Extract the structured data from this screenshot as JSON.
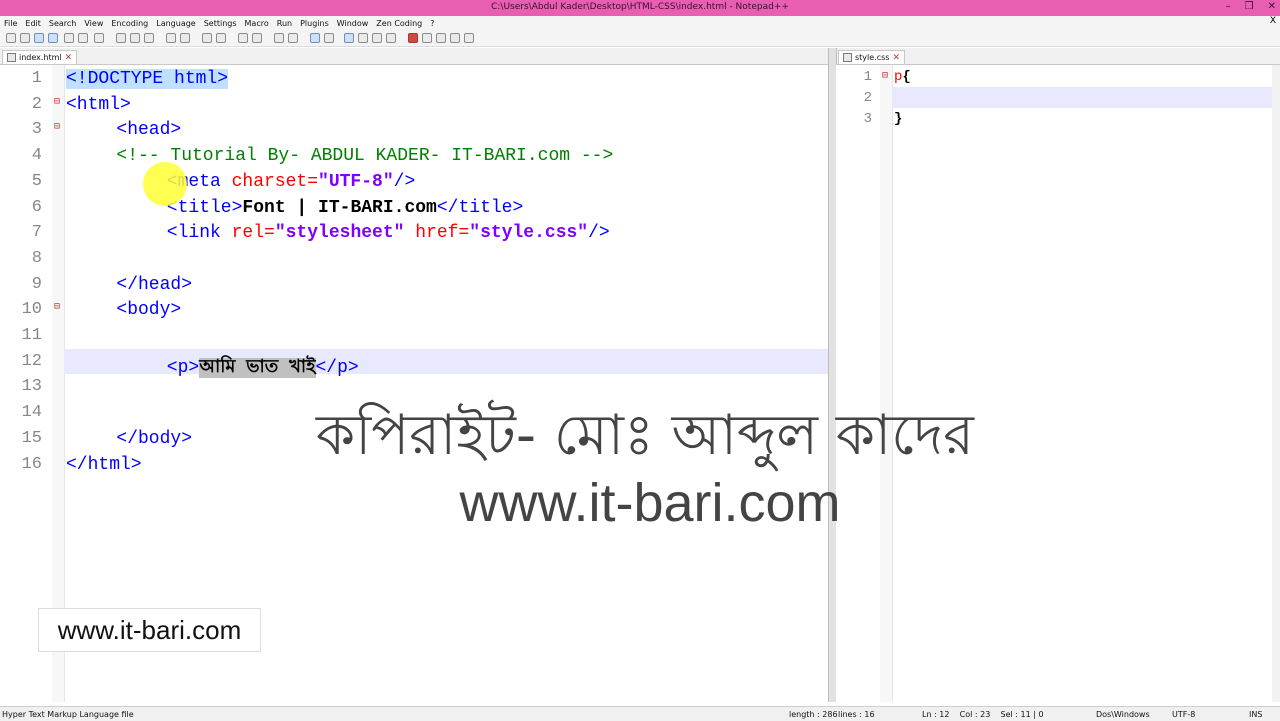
{
  "window": {
    "title": "C:\\Users\\Abdul Kader\\Desktop\\HTML-CSS\\index.html - Notepad++",
    "controls": [
      "–",
      "❒",
      "✕"
    ]
  },
  "menu": [
    "File",
    "Edit",
    "Search",
    "View",
    "Encoding",
    "Language",
    "Settings",
    "Macro",
    "Run",
    "Plugins",
    "Window",
    "Zen Coding",
    "?"
  ],
  "menu_close": "X",
  "colors": {
    "titlebar": "#e85fb1",
    "tag": "#0000ff",
    "attr": "#ff0000",
    "string": "#8000ff",
    "comment": "#008000",
    "highlight_line": "#e8e8ff"
  },
  "tabs": {
    "left": {
      "label": "index.html",
      "close": "✕"
    },
    "right": {
      "label": "style.css",
      "close": "✕"
    }
  },
  "left_editor": {
    "line_numbers": [
      "1",
      "2",
      "3",
      "4",
      "5",
      "6",
      "7",
      "8",
      "9",
      "10",
      "11",
      "12",
      "13",
      "14",
      "15",
      "16"
    ],
    "lines": [
      {
        "indent": 0,
        "tokens": [
          {
            "t": "<!DOCTYPE html>",
            "c": "tag match"
          }
        ]
      },
      {
        "indent": 0,
        "tokens": [
          {
            "t": "<html>",
            "c": "tag"
          }
        ]
      },
      {
        "indent": 4,
        "tokens": [
          {
            "t": "<head>",
            "c": "tag"
          }
        ]
      },
      {
        "indent": 4,
        "tokens": [
          {
            "t": "<!-- Tutorial By- ABDUL KADER- IT-BARI.com -->",
            "c": "cmt"
          }
        ]
      },
      {
        "indent": 8,
        "tokens": [
          {
            "t": "<meta ",
            "c": "tag"
          },
          {
            "t": "charset=",
            "c": "attr"
          },
          {
            "t": "\"UTF-8\"",
            "c": "str"
          },
          {
            "t": "/>",
            "c": "tag"
          }
        ]
      },
      {
        "indent": 8,
        "tokens": [
          {
            "t": "<title>",
            "c": "tag"
          },
          {
            "t": "Font | IT-BARI.com",
            "c": "txt"
          },
          {
            "t": "</title>",
            "c": "tag"
          }
        ]
      },
      {
        "indent": 8,
        "tokens": [
          {
            "t": "<link ",
            "c": "tag"
          },
          {
            "t": "rel=",
            "c": "attr"
          },
          {
            "t": "\"stylesheet\"",
            "c": "str"
          },
          {
            "t": " ",
            "c": "tag"
          },
          {
            "t": "href=",
            "c": "attr"
          },
          {
            "t": "\"style.css\"",
            "c": "str"
          },
          {
            "t": "/>",
            "c": "tag"
          }
        ]
      },
      {
        "indent": 0,
        "tokens": []
      },
      {
        "indent": 4,
        "tokens": [
          {
            "t": "</head>",
            "c": "tag"
          }
        ]
      },
      {
        "indent": 4,
        "tokens": [
          {
            "t": "<body>",
            "c": "tag"
          }
        ]
      },
      {
        "indent": 0,
        "tokens": []
      },
      {
        "indent": 8,
        "tokens": [
          {
            "t": "<p>",
            "c": "tag"
          },
          {
            "t": "আমি ভাত খাই",
            "c": "txt sel"
          },
          {
            "t": "</p>",
            "c": "tag"
          }
        ]
      },
      {
        "indent": 0,
        "tokens": []
      },
      {
        "indent": 0,
        "tokens": []
      },
      {
        "indent": 4,
        "tokens": [
          {
            "t": "</body>",
            "c": "tag"
          }
        ]
      },
      {
        "indent": 0,
        "tokens": [
          {
            "t": "</html>",
            "c": "tag"
          }
        ]
      }
    ],
    "fold_markers": {
      "2": "⊟",
      "3": "⊟",
      "10": "⊟"
    }
  },
  "right_editor": {
    "line_numbers": [
      "1",
      "2",
      "3"
    ],
    "lines": [
      {
        "tokens": [
          {
            "t": "p",
            "c": "attr"
          },
          {
            "t": "{",
            "c": "txt"
          }
        ]
      },
      {
        "tokens": []
      },
      {
        "tokens": [
          {
            "t": "}",
            "c": "txt"
          }
        ]
      }
    ],
    "fold_markers": {
      "1": "⊟"
    }
  },
  "watermark": {
    "line1": "কপিরাইট- মোঃ আব্দুল কাদের",
    "line2": "www.it-bari.com"
  },
  "badge": "www.it-bari.com",
  "status": {
    "file_type": "Hyper Text Markup Language file",
    "length": "length : 286",
    "lines": "lines : 16",
    "position": "Ln : 12    Col : 23    Sel : 11 | 0",
    "eol": "Dos\\Windows",
    "encoding": "UTF-8",
    "mode": "INS"
  }
}
